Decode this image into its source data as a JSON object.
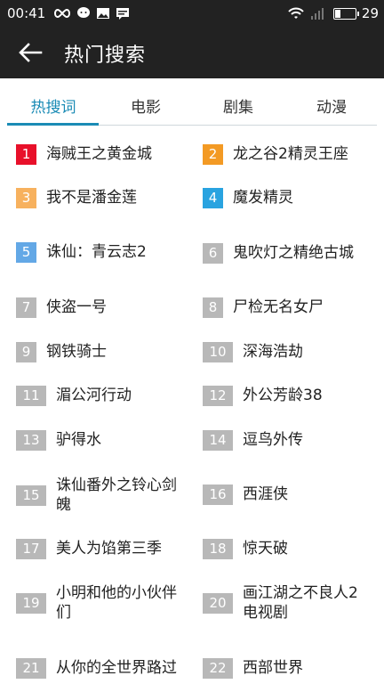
{
  "status_bar": {
    "time": "00:41",
    "battery_level": "29"
  },
  "header": {
    "title": "热门搜索"
  },
  "tabs": [
    {
      "label": "热搜词"
    },
    {
      "label": "电影"
    },
    {
      "label": "剧集"
    },
    {
      "label": "动漫"
    }
  ],
  "colors": {
    "rank_1": "#e8102a",
    "rank_2": "#f39a24",
    "rank_3": "#f7b15e",
    "rank_4": "#29a3e0",
    "rank_5": "#63a8e6",
    "rank_other": "#b8b8b8",
    "accent": "#1a8bb5"
  },
  "hot_list": [
    {
      "rank": "1",
      "title": "海贼王之黄金城"
    },
    {
      "rank": "2",
      "title": "龙之谷2精灵王座"
    },
    {
      "rank": "3",
      "title": "我不是潘金莲"
    },
    {
      "rank": "4",
      "title": "魔发精灵"
    },
    {
      "rank": "5",
      "title": "诛仙：青云志2"
    },
    {
      "rank": "6",
      "title": "鬼吹灯之精绝古城"
    },
    {
      "rank": "7",
      "title": "侠盗一号"
    },
    {
      "rank": "8",
      "title": "尸检无名女尸"
    },
    {
      "rank": "9",
      "title": "钢铁骑士"
    },
    {
      "rank": "10",
      "title": "深海浩劫"
    },
    {
      "rank": "11",
      "title": "湄公河行动"
    },
    {
      "rank": "12",
      "title": "外公芳龄38"
    },
    {
      "rank": "13",
      "title": "驴得水"
    },
    {
      "rank": "14",
      "title": "逗鸟外传"
    },
    {
      "rank": "15",
      "title": "诛仙番外之铃心剑魄"
    },
    {
      "rank": "16",
      "title": "西涯侠"
    },
    {
      "rank": "17",
      "title": "美人为馅第三季"
    },
    {
      "rank": "18",
      "title": "惊天破"
    },
    {
      "rank": "19",
      "title": "小明和他的小伙伴们"
    },
    {
      "rank": "20",
      "title": "画江湖之不良人2电视剧"
    },
    {
      "rank": "21",
      "title": "从你的全世界路过"
    },
    {
      "rank": "22",
      "title": "西部世界"
    }
  ]
}
